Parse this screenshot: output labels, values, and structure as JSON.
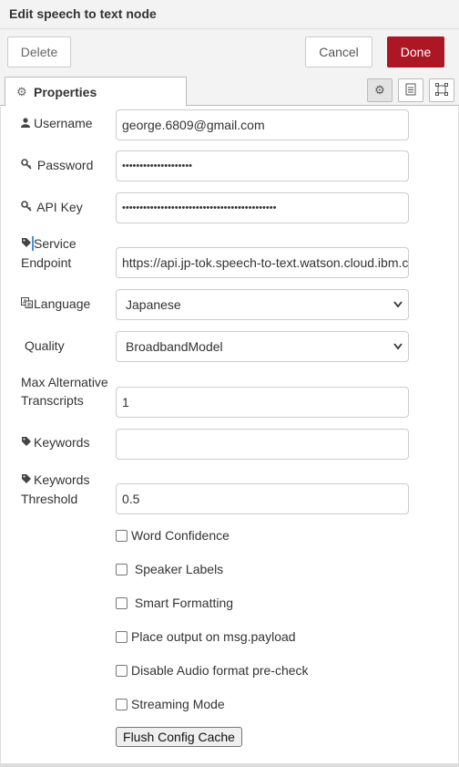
{
  "title": "Edit speech to text node",
  "buttons": {
    "delete": "Delete",
    "cancel": "Cancel",
    "done": "Done"
  },
  "tab": {
    "label": "Properties"
  },
  "fields": {
    "username": {
      "label": "Username",
      "value": "george.6809@gmail.com"
    },
    "password": {
      "label": "Password",
      "value": "••••••••••••••••••••"
    },
    "apikey": {
      "label": "API Key",
      "value": "••••••••••••••••••••••••••••••••••••••••••••"
    },
    "endpoint": {
      "label1": "Service",
      "label2": "Endpoint",
      "value": "https://api.jp-tok.speech-to-text.watson.cloud.ibm.com"
    },
    "language": {
      "label": "Language",
      "value": "Japanese"
    },
    "quality": {
      "label": "Quality",
      "value": "BroadbandModel"
    },
    "max_alt": {
      "label1": "Max Alternative",
      "label2": "Transcripts",
      "value": "1"
    },
    "keywords": {
      "label": "Keywords",
      "value": ""
    },
    "threshold": {
      "label1": "Keywords",
      "label2": "Threshold",
      "value": "0.5"
    }
  },
  "checkboxes": {
    "word_conf": "Word Confidence",
    "speaker": " Speaker Labels",
    "smart": " Smart Formatting",
    "payload": "Place output on msg.payload",
    "disable_audio": "Disable Audio format pre-check",
    "streaming": "Streaming Mode"
  },
  "flush_label": "Flush Config Cache"
}
